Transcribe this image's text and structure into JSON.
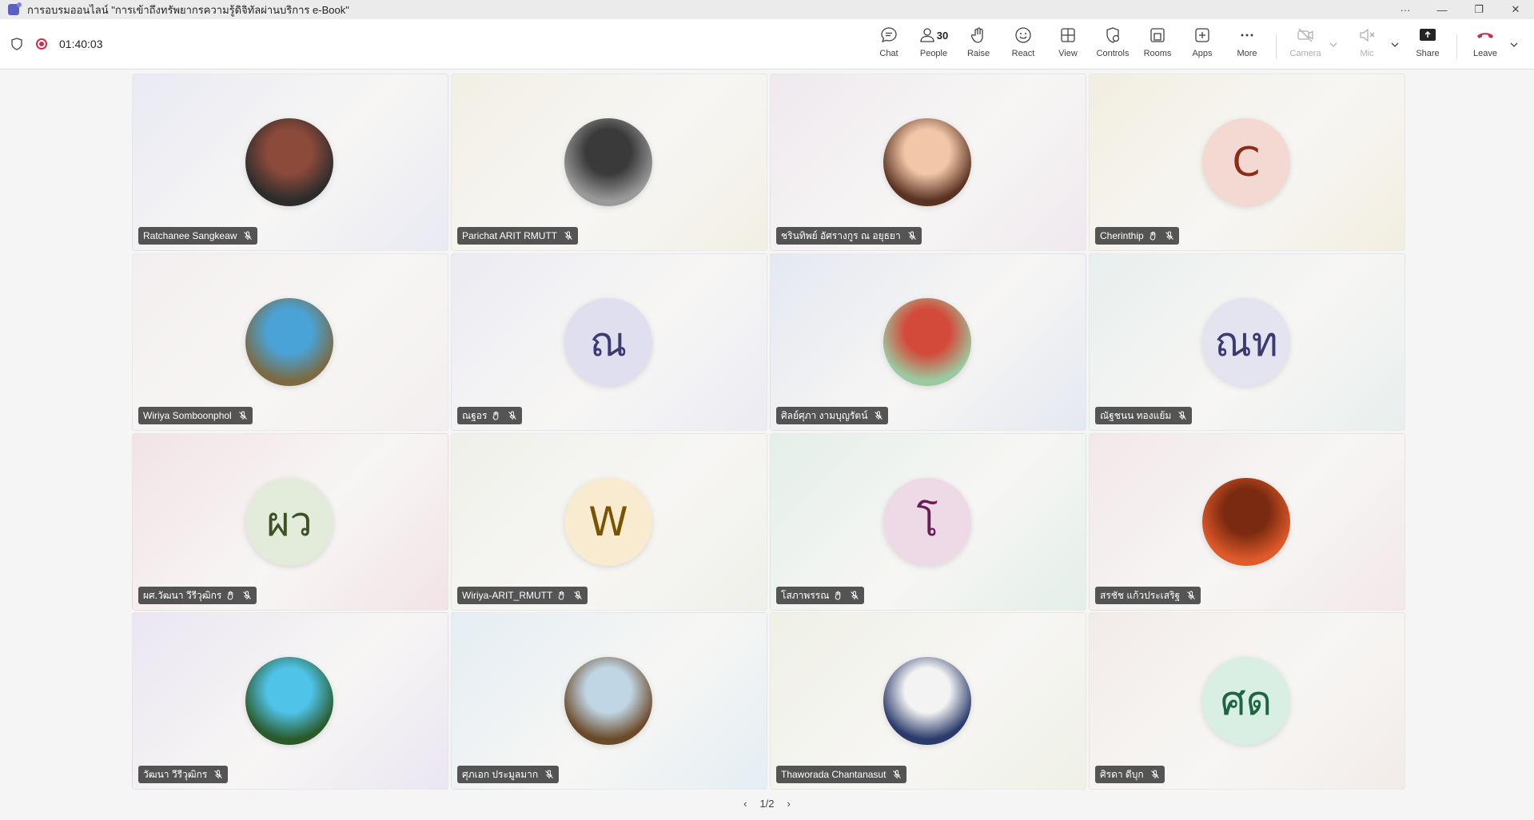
{
  "window": {
    "title": "การอบรมออนไลน์ \"การเข้าถึงทรัพยากรความรู้ดิจิทัลผ่านบริการ e-Book\"",
    "controls": [
      "···",
      "—",
      "❐",
      "✕"
    ]
  },
  "toolbar": {
    "timer": "01:40:03",
    "chat": "Chat",
    "people": "People",
    "people_count": "30",
    "raise": "Raise",
    "react": "React",
    "view": "View",
    "controls": "Controls",
    "rooms": "Rooms",
    "apps": "Apps",
    "more": "More",
    "camera": "Camera",
    "mic": "Mic",
    "share": "Share",
    "leave": "Leave"
  },
  "participants": [
    {
      "name": "Ratchanee Sangkeaw",
      "avatar": "photo",
      "hand": false,
      "bg": "#e9eaf3"
    },
    {
      "name": "Parichat ARIT RMUTT",
      "avatar": "photo",
      "hand": false,
      "bg": "#f2efe4"
    },
    {
      "name": "ชรินทิพย์ อัศรางกูร ณ อยุธยา",
      "avatar": "photo",
      "hand": false,
      "bg": "#efe9ef"
    },
    {
      "name": "Cherinthip",
      "avatar": "C",
      "avatar_bg": "#f3d9d2",
      "avatar_fg": "#8a2c18",
      "hand": true,
      "bg": "#f2eee0"
    },
    {
      "name": "Wiriya Somboonphol",
      "avatar": "photo",
      "hand": false,
      "bg": "#f3eeef"
    },
    {
      "name": "ณฐอร",
      "avatar": "ณ",
      "avatar_bg": "#e0dff0",
      "avatar_fg": "#3d3a73",
      "hand": true,
      "bg": "#ecebf3"
    },
    {
      "name": "ศิลย์ศุภา งามบุญรัตน์",
      "avatar": "photo",
      "hand": false,
      "bg": "#e4e8f1"
    },
    {
      "name": "ณัฐชนน ทองแย้ม",
      "avatar": "ณท",
      "avatar_bg": "#e4e4f0",
      "avatar_fg": "#3d3a73",
      "hand": false,
      "bg": "#e8efee"
    },
    {
      "name": "ผศ.วัฒนา วีรีวุฒิกร",
      "avatar": "ผว",
      "avatar_bg": "#e3ebdb",
      "avatar_fg": "#3c5224",
      "hand": true,
      "bg": "#f2e3e6"
    },
    {
      "name": "Wiriya-ARIT_RMUTT",
      "avatar": "W",
      "avatar_bg": "#f8ebcf",
      "avatar_fg": "#7a5300",
      "hand": true,
      "bg": "#eff0ea"
    },
    {
      "name": "โสภาพรรณ",
      "avatar": "โ",
      "avatar_bg": "#eed9e7",
      "avatar_fg": "#6b1e55",
      "hand": true,
      "bg": "#e4efe9"
    },
    {
      "name": "สรชัช แก้วประเสริฐ",
      "avatar": "photo",
      "hand": false,
      "bg": "#f2e8ea"
    },
    {
      "name": "วัฒนา วีรีวุฒิกร",
      "avatar": "photo",
      "hand": false,
      "bg": "#ebe6f2"
    },
    {
      "name": "ศุภเอก ประมูลมาก",
      "avatar": "photo",
      "hand": false,
      "bg": "#e4eef3"
    },
    {
      "name": "Thaworada Chantanasut",
      "avatar": "photo",
      "hand": false,
      "bg": "#eff0e6"
    },
    {
      "name": "ศิรดา ดีบุก",
      "avatar": "ศด",
      "avatar_bg": "#d9efe3",
      "avatar_fg": "#1e6543",
      "hand": false,
      "bg": "#f2ece9"
    }
  ],
  "pager": {
    "label": "1/2"
  }
}
